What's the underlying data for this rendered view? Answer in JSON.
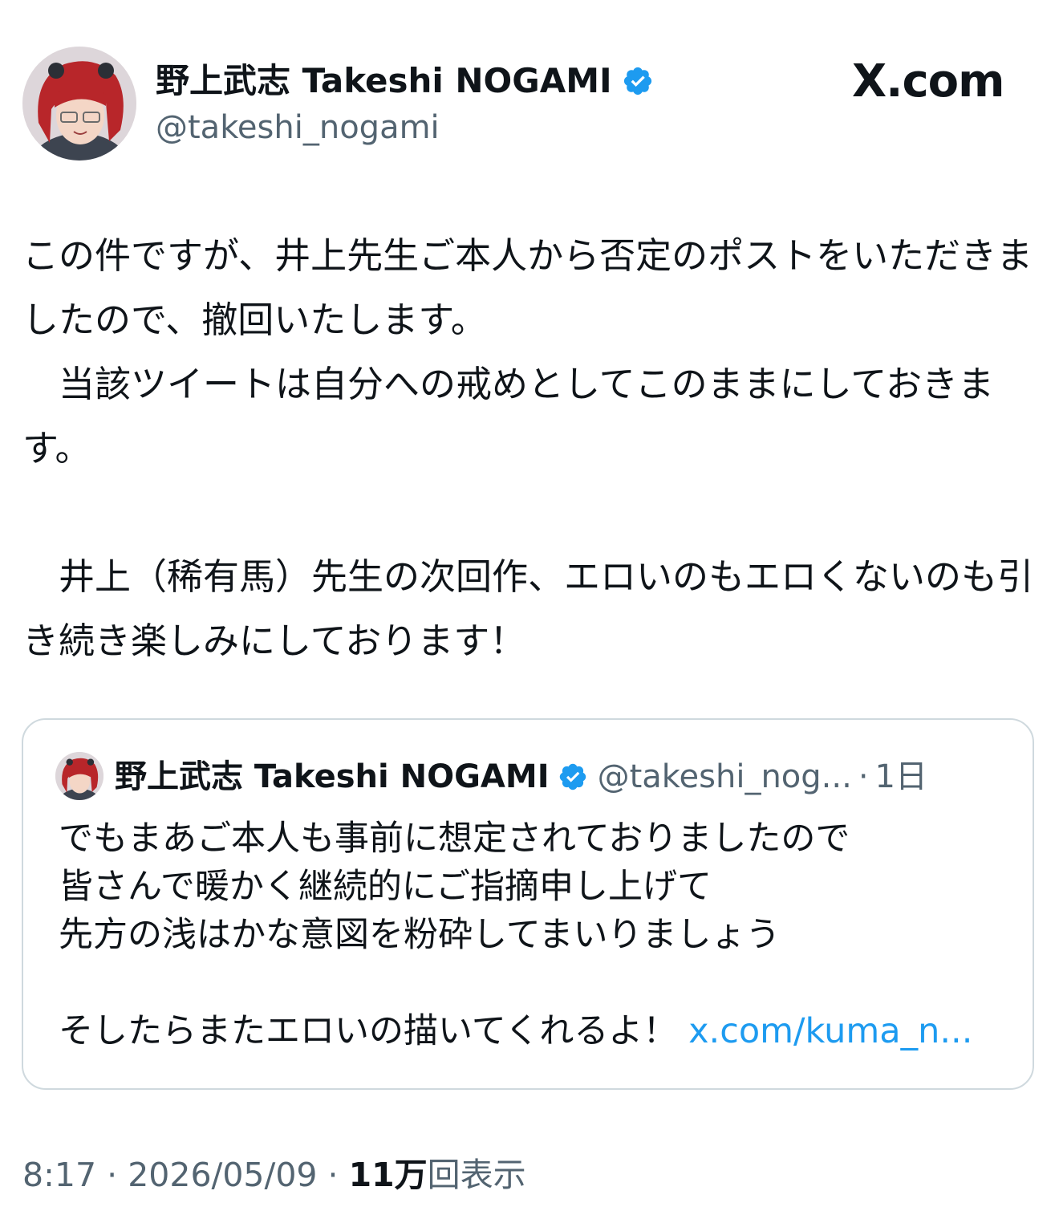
{
  "author": {
    "name": "野上武志 Takeshi NOGAMI",
    "handle": "@takeshi_nogami",
    "verified_color": "#1d9bf0"
  },
  "brand": {
    "label": "X.com"
  },
  "post": {
    "paragraphs": [
      "この件ですが、井上先生ご本人から否定のポストをいただきましたので、撤回いたします。",
      "　当該ツイートは自分への戒めとしてこのままにしておきます。",
      "",
      "　井上（稀有馬）先生の次回作、エロいのもエロくないのも引き続き楽しみにしております！"
    ]
  },
  "quoted": {
    "name": "野上武志 Takeshi NOGAMI",
    "handle": "@takeshi_nog...",
    "separator": "·",
    "time": "1日",
    "lines": [
      "でもまあご本人も事前に想定されておりましたので",
      "皆さんで暖かく継続的にご指摘申し上げて",
      "先方の浅はかな意図を粉砕してまいりましょう",
      ""
    ],
    "last_line": "そしたらまたエロいの描いてくれるよ！",
    "link": "x.com/kuma_n..."
  },
  "meta": {
    "time": "8:17",
    "sep1": " · ",
    "date": "2026/05/09",
    "sep2": " · ",
    "views": "11万",
    "views_label": "回表示"
  },
  "icons": {
    "verified": "verified-badge-icon",
    "x_logo": "x-logo"
  }
}
